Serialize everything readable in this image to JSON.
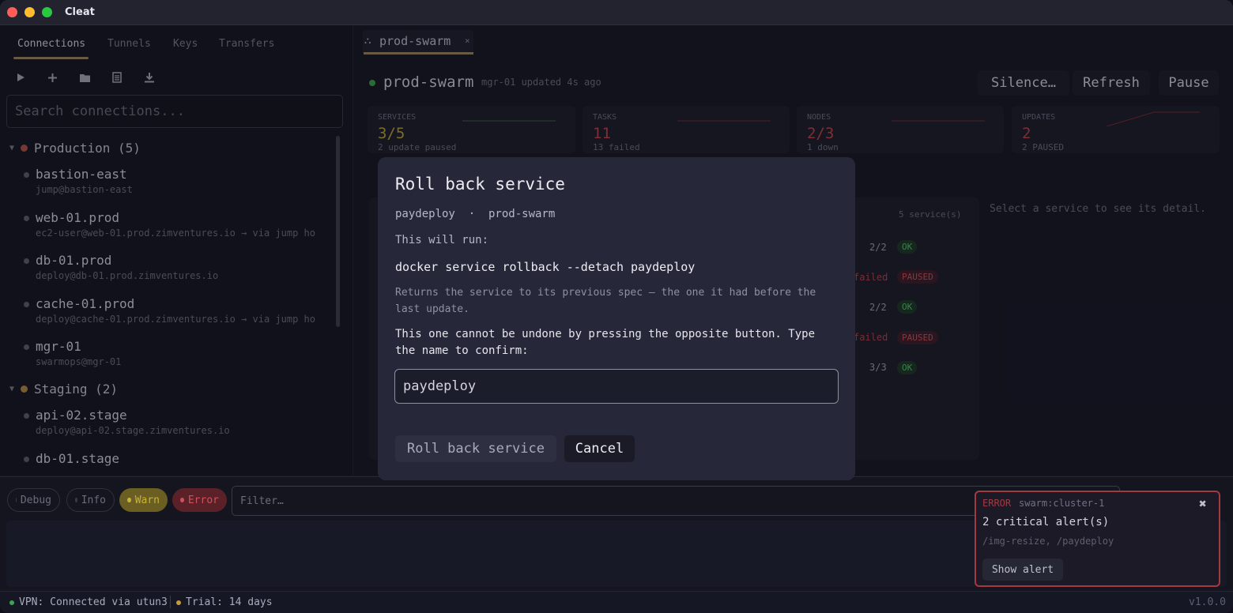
{
  "app": {
    "title": "Cleat"
  },
  "sidebar": {
    "tabs": [
      {
        "label": "Connections"
      },
      {
        "label": "Tunnels"
      },
      {
        "label": "Keys"
      },
      {
        "label": "Transfers"
      }
    ],
    "toolbar_icons": [
      "play-icon",
      "plus-icon",
      "folder-icon",
      "document-icon",
      "download-icon"
    ],
    "search_placeholder": "Search connections...",
    "groups": [
      {
        "label": "Production (5)",
        "color": "#b25448",
        "connections": [
          {
            "name": "bastion-east",
            "target": "jump@bastion-east"
          },
          {
            "name": "web-01.prod",
            "target": "ec2-user@web-01.prod.zimventures.io  → via jump ho"
          },
          {
            "name": "db-01.prod",
            "target": "deploy@db-01.prod.zimventures.io"
          },
          {
            "name": "cache-01.prod",
            "target": "deploy@cache-01.prod.zimventures.io  → via jump ho"
          },
          {
            "name": "mgr-01",
            "target": "swarmops@mgr-01"
          }
        ]
      },
      {
        "label": "Staging (2)",
        "color": "#b58a44",
        "connections": [
          {
            "name": "api-02.stage",
            "target": "deploy@api-02.stage.zimventures.io"
          },
          {
            "name": "db-01.stage",
            "target": ""
          }
        ]
      }
    ]
  },
  "main": {
    "tab": {
      "label": "prod-swarm",
      "close": "×"
    },
    "header": {
      "title": "prod-swarm",
      "subtitle": "mgr-01  updated 4s ago",
      "buttons": {
        "silence": "Silence…",
        "refresh": "Refresh",
        "pause": "Pause"
      }
    },
    "stats": [
      {
        "label": "SERVICES",
        "value": "3/5",
        "sub": "2 update paused",
        "color": "#b9a63a"
      },
      {
        "label": "TASKS",
        "value": "11",
        "sub": "13 failed",
        "color": "#c0444f"
      },
      {
        "label": "NODES",
        "value": "2/3",
        "sub": "1 down",
        "color": "#c0444f"
      },
      {
        "label": "UPDATES",
        "value": "2",
        "sub": "2 PAUSED",
        "color": "#c0444f"
      }
    ],
    "services": {
      "count_label": "5 service(s)",
      "visible_fragments": [
        {
          "replicas": "2/2",
          "status": "OK"
        },
        {
          "replicas": "failed",
          "status": "PAUSED"
        },
        {
          "replicas": "2/2",
          "status": "OK"
        },
        {
          "replicas": "failed",
          "status": "PAUSED"
        },
        {
          "replicas": "3/3",
          "status": "OK"
        }
      ]
    },
    "detail_hint": "Select a service to see its detail."
  },
  "modal": {
    "title": "Roll back service",
    "subtitle": "paydeploy  ·  prod-swarm",
    "run_label": "This will run:",
    "command": "docker service rollback --detach paydeploy",
    "description": "Returns the service to its previous spec — the one it had before the last update.",
    "warning": "This one cannot be undone by pressing the opposite button. Type the name to confirm:",
    "input_value": "paydeploy",
    "confirm_label": "Roll back service",
    "cancel_label": "Cancel"
  },
  "log": {
    "levels": [
      {
        "label": "Debug",
        "dot": "#3a3b4a"
      },
      {
        "label": "Info",
        "dot": "#3a3b4a"
      },
      {
        "label": "Warn",
        "dot": "#c9b23a"
      },
      {
        "label": "Error",
        "dot": "#d0505c"
      }
    ],
    "filter_placeholder": "Filter…"
  },
  "toast": {
    "level": "ERROR",
    "source": "swarm:cluster-1",
    "close": "✖",
    "message": "2 critical alert(s)",
    "detail": "/img-resize, /paydeploy",
    "button": "Show alert"
  },
  "statusbar": {
    "vpn": "VPN: Connected via utun3",
    "trial": "Trial: 14 days",
    "version": "v1.0.0"
  }
}
